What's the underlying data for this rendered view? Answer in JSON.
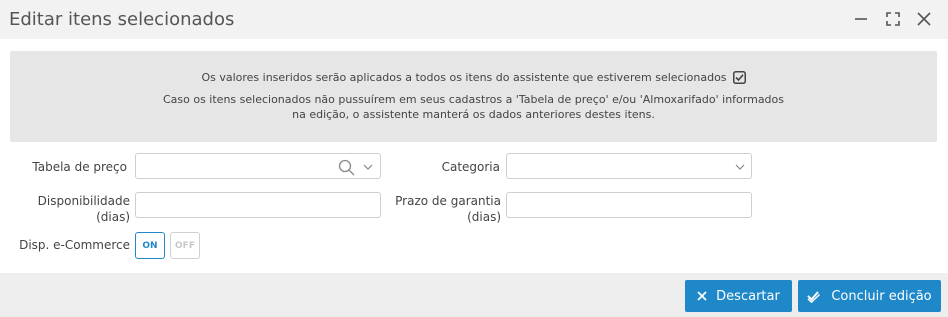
{
  "dialog": {
    "title": "Editar itens selecionados"
  },
  "window_controls": {
    "minimize_icon": "minimize-icon",
    "maximize_icon": "maximize-icon",
    "close_icon": "close-icon"
  },
  "info": {
    "line1": "Os valores inseridos serão aplicados a todos os itens do assistente que estiverem selecionados",
    "line2": "Caso os itens selecionados não pussuírem em seus cadastros a 'Tabela de preço' e/ou 'Almoxarifado' informados",
    "line3": "na edição, o assistente manterá os dados anteriores destes itens.",
    "checkbox_icon": "checkbox-checked-icon"
  },
  "form": {
    "tabela_preco": {
      "label": "Tabela de preço",
      "value": ""
    },
    "categoria": {
      "label": "Categoria",
      "value": ""
    },
    "disponibilidade": {
      "label_line1": "Disponibilidade",
      "label_line2": "(dias)",
      "value": ""
    },
    "prazo_garantia": {
      "label_line1": "Prazo de garantia",
      "label_line2": "(dias)",
      "value": ""
    },
    "disp_ecommerce": {
      "label": "Disp. e-Commerce",
      "on_label": "ON",
      "off_label": "OFF",
      "selected": "ON"
    }
  },
  "footer": {
    "discard_label": "Descartar",
    "confirm_label": "Concluir edição"
  },
  "colors": {
    "accent": "#1e88c8",
    "titlebar_bg": "#f2f2f2",
    "info_bg": "#e6e6e6",
    "footer_bg": "#eeeeee"
  }
}
